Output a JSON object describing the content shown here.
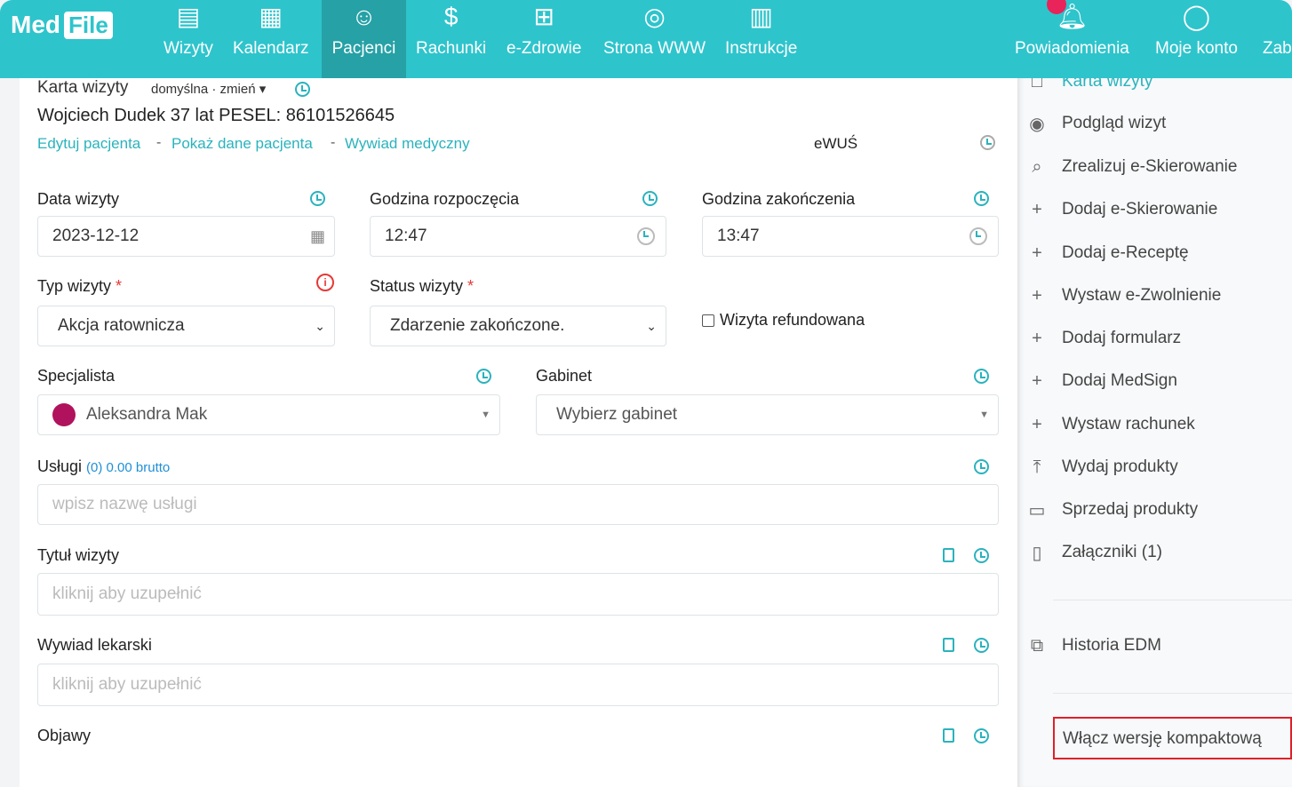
{
  "header": {
    "logo": {
      "part1": "Med",
      "part2": "File"
    },
    "nav": [
      {
        "label": "Wizyty",
        "icon": "clipboard-list-icon"
      },
      {
        "label": "Kalendarz",
        "icon": "calendar-icon"
      },
      {
        "label": "Pacjenci",
        "icon": "users-icon",
        "active": true
      },
      {
        "label": "Rachunki",
        "icon": "dollar-icon"
      },
      {
        "label": "e-Zdrowie",
        "icon": "medical-plus-icon"
      },
      {
        "label": "Strona WWW",
        "icon": "globe-icon"
      },
      {
        "label": "Instrukcje",
        "icon": "book-icon"
      }
    ],
    "right": [
      {
        "label": "Powiadomienia",
        "icon": "bell-icon"
      },
      {
        "label": "Moje konto",
        "icon": "user-icon"
      },
      {
        "label": "Zab",
        "icon": ""
      }
    ]
  },
  "card": {
    "title": "Karta wizyty",
    "template": "domyślna · zmień",
    "patient": "Wojciech Dudek 37 lat PESEL: 86101526645",
    "links": [
      "Edytuj pacjenta",
      "Pokaż dane pacjenta",
      "Wywiad medyczny"
    ],
    "sep": "-",
    "ewus": "eWUŚ"
  },
  "form": {
    "date": {
      "label": "Data wizyty",
      "value": "2023-12-12"
    },
    "start": {
      "label": "Godzina rozpoczęcia",
      "value": "12:47"
    },
    "end": {
      "label": "Godzina zakończenia",
      "value": "13:47"
    },
    "type": {
      "label": "Typ wizyty",
      "required": "*",
      "value": "Akcja ratownicza"
    },
    "status": {
      "label": "Status wizyty",
      "required": "*",
      "value": "Zdarzenie zakończone."
    },
    "refund": {
      "label": "Wizyta refundowana",
      "checked": false
    },
    "specialist": {
      "label": "Specjalista",
      "value": "Aleksandra Mak",
      "color": "#b0125e"
    },
    "room": {
      "label": "Gabinet",
      "placeholder": "Wybierz gabinet"
    },
    "services": {
      "label": "Usługi",
      "summary": "(0) 0.00 brutto",
      "placeholder": "wpisz nazwę usługi"
    },
    "title": {
      "label": "Tytuł wizyty",
      "placeholder": "kliknij aby uzupełnić"
    },
    "interview": {
      "label": "Wywiad lekarski",
      "placeholder": "kliknij aby uzupełnić"
    },
    "symptoms": {
      "label": "Objawy"
    }
  },
  "sidebar": {
    "items": [
      {
        "label": "Karta wizyty",
        "icon": "square-icon"
      },
      {
        "label": "Podgląd wizyt",
        "icon": "eye-icon"
      },
      {
        "label": "Zrealizuj e-Skierowanie",
        "icon": "search-icon"
      },
      {
        "label": "Dodaj e-Skierowanie",
        "icon": "plus-icon"
      },
      {
        "label": "Dodaj e-Receptę",
        "icon": "plus-icon"
      },
      {
        "label": "Wystaw e-Zwolnienie",
        "icon": "plus-icon"
      },
      {
        "label": "Dodaj formularz",
        "icon": "plus-icon"
      },
      {
        "label": "Dodaj MedSign",
        "icon": "plus-icon"
      },
      {
        "label": "Wystaw rachunek",
        "icon": "plus-icon"
      },
      {
        "label": "Wydaj produkty",
        "icon": "upload-icon"
      },
      {
        "label": "Sprzedaj produkty",
        "icon": "banknote-icon"
      },
      {
        "label": "Załączniki (1)",
        "icon": "file-icon"
      }
    ],
    "history": {
      "label": "Historia EDM",
      "icon": "file-copy-icon"
    },
    "compact": "Włącz wersję kompaktową"
  },
  "colors": {
    "accent": "#2ec4cc",
    "active_nav": "#26a1a6",
    "link": "#2ab3bd",
    "highlight": "#e0202a"
  }
}
